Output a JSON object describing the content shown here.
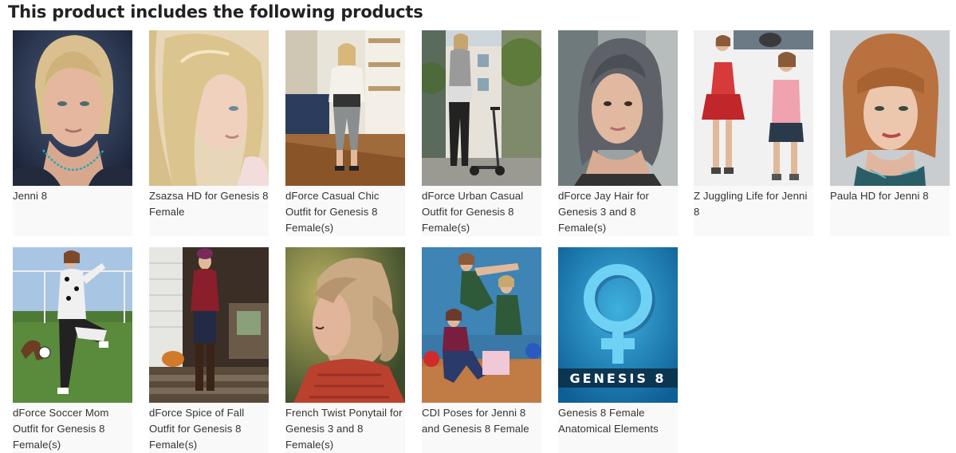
{
  "section": {
    "title": "This product includes the following products"
  },
  "products": [
    {
      "name": "Jenni 8",
      "thumb": "portrait-blonde-woman"
    },
    {
      "name": "Zsazsa HD for Genesis 8 Female",
      "thumb": "portrait-platinum-hair"
    },
    {
      "name": "dForce Casual Chic Outfit for Genesis 8 Female(s)",
      "thumb": "woman-living-room"
    },
    {
      "name": "dForce Urban Casual Outfit for Genesis 8 Female(s)",
      "thumb": "woman-scooter-street"
    },
    {
      "name": "dForce Jay Hair for Genesis 3 and 8 Female(s)",
      "thumb": "portrait-grey-hair"
    },
    {
      "name": "Z Juggling Life for Jenni 8",
      "thumb": "two-women-poses"
    },
    {
      "name": "Paula HD for Jenni 8",
      "thumb": "portrait-auburn-bob"
    },
    {
      "name": "dForce Soccer Mom Outfit for Genesis 8 Female(s)",
      "thumb": "woman-soccer-field"
    },
    {
      "name": "dForce Spice of Fall Outfit for Genesis 8 Female(s)",
      "thumb": "woman-porch-autumn"
    },
    {
      "name": "French Twist Ponytail for Genesis 3 and 8 Female(s)",
      "thumb": "ponytail-red-sweater"
    },
    {
      "name": "CDI Poses for Jenni 8 and Genesis 8 Female",
      "thumb": "women-posing-group"
    },
    {
      "name": "Genesis 8 Female Anatomical Elements",
      "thumb": "female-symbol-logo"
    }
  ],
  "logo": {
    "genesis_text": "GENESIS 8"
  }
}
